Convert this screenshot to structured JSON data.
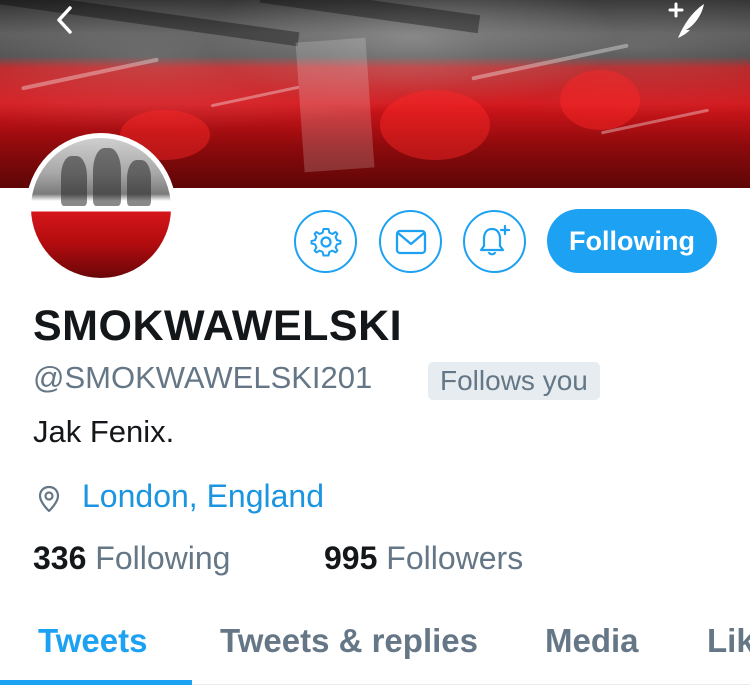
{
  "profile": {
    "name": "SMOKWAWELSKI",
    "handle": "@SMOKWAWELSKI201",
    "follows_you_badge": "Follows you",
    "bio": "Jak Fenix.",
    "location": "London, England"
  },
  "actions": {
    "following_label": "Following",
    "settings_icon": "gear-icon",
    "message_icon": "envelope-icon",
    "notify_icon": "bell-plus-icon"
  },
  "stats": {
    "following_count": "336",
    "following_label": "Following",
    "followers_count": "995",
    "followers_label": "Followers"
  },
  "tabs": [
    {
      "label": "Tweets",
      "active": true
    },
    {
      "label": "Tweets & replies",
      "active": false
    },
    {
      "label": "Media",
      "active": false
    },
    {
      "label": "Lik",
      "active": false
    }
  ],
  "colors": {
    "accent": "#1da1f2",
    "link": "#1b95e0",
    "secondary_text": "#657786",
    "badge_bg": "#e6ecf0"
  }
}
